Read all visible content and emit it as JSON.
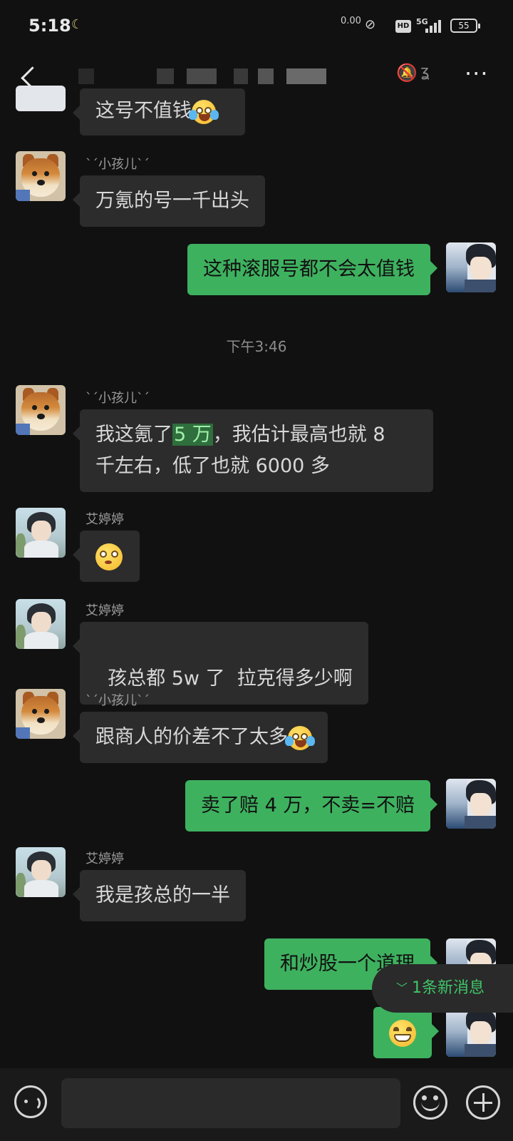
{
  "status_bar": {
    "time": "5:18",
    "net_speed": "0.00",
    "network": "5G",
    "hd": "HD",
    "battery": "55"
  },
  "header": {
    "title_obscured": "",
    "icons": [
      "back-icon",
      "mute-icon",
      "ear-icon",
      "more-icon"
    ]
  },
  "messages": [
    {
      "side": "left",
      "sender": "",
      "text": "这号不值钱",
      "emoji": "crying-laughing"
    },
    {
      "side": "left",
      "sender": "ˋˊ小孩儿ˋˊ",
      "text": "万氪的号一千出头"
    },
    {
      "side": "right",
      "text": "这种滚服号都不会太值钱"
    },
    {
      "timestamp": "下午3:46"
    },
    {
      "side": "left",
      "sender": "ˋˊ小孩儿ˋˊ",
      "text_before": "我这氪了",
      "highlight": "5 万",
      "text_after": "，我估计最高也就 8",
      "text_line2": "千左右，低了也就 6000 多"
    },
    {
      "side": "left",
      "sender": "艾婷婷",
      "emoji": "flushed"
    },
    {
      "side": "left",
      "sender": "艾婷婷",
      "text": "孩总都 5w 了  拉克得多少啊"
    },
    {
      "side": "left",
      "sender": "ˋˊ小孩儿ˋˊ",
      "text": "跟商人的价差不了太多",
      "emoji": "crying-laughing"
    },
    {
      "side": "right",
      "text": "卖了赔 4 万，不卖=不赔"
    },
    {
      "side": "left",
      "sender": "艾婷婷",
      "text": "我是孩总的一半"
    },
    {
      "side": "right",
      "text": "和炒股一个道理"
    },
    {
      "side": "right",
      "emoji": "grinning"
    }
  ],
  "new_message_pill": {
    "label": "1条新消息"
  },
  "input_bar": {
    "placeholder": "",
    "value": ""
  },
  "colors": {
    "background": "#111111",
    "bubble_left": "#2c2c2c",
    "bubble_right": "#3eb15f",
    "accent": "#3fc467"
  }
}
